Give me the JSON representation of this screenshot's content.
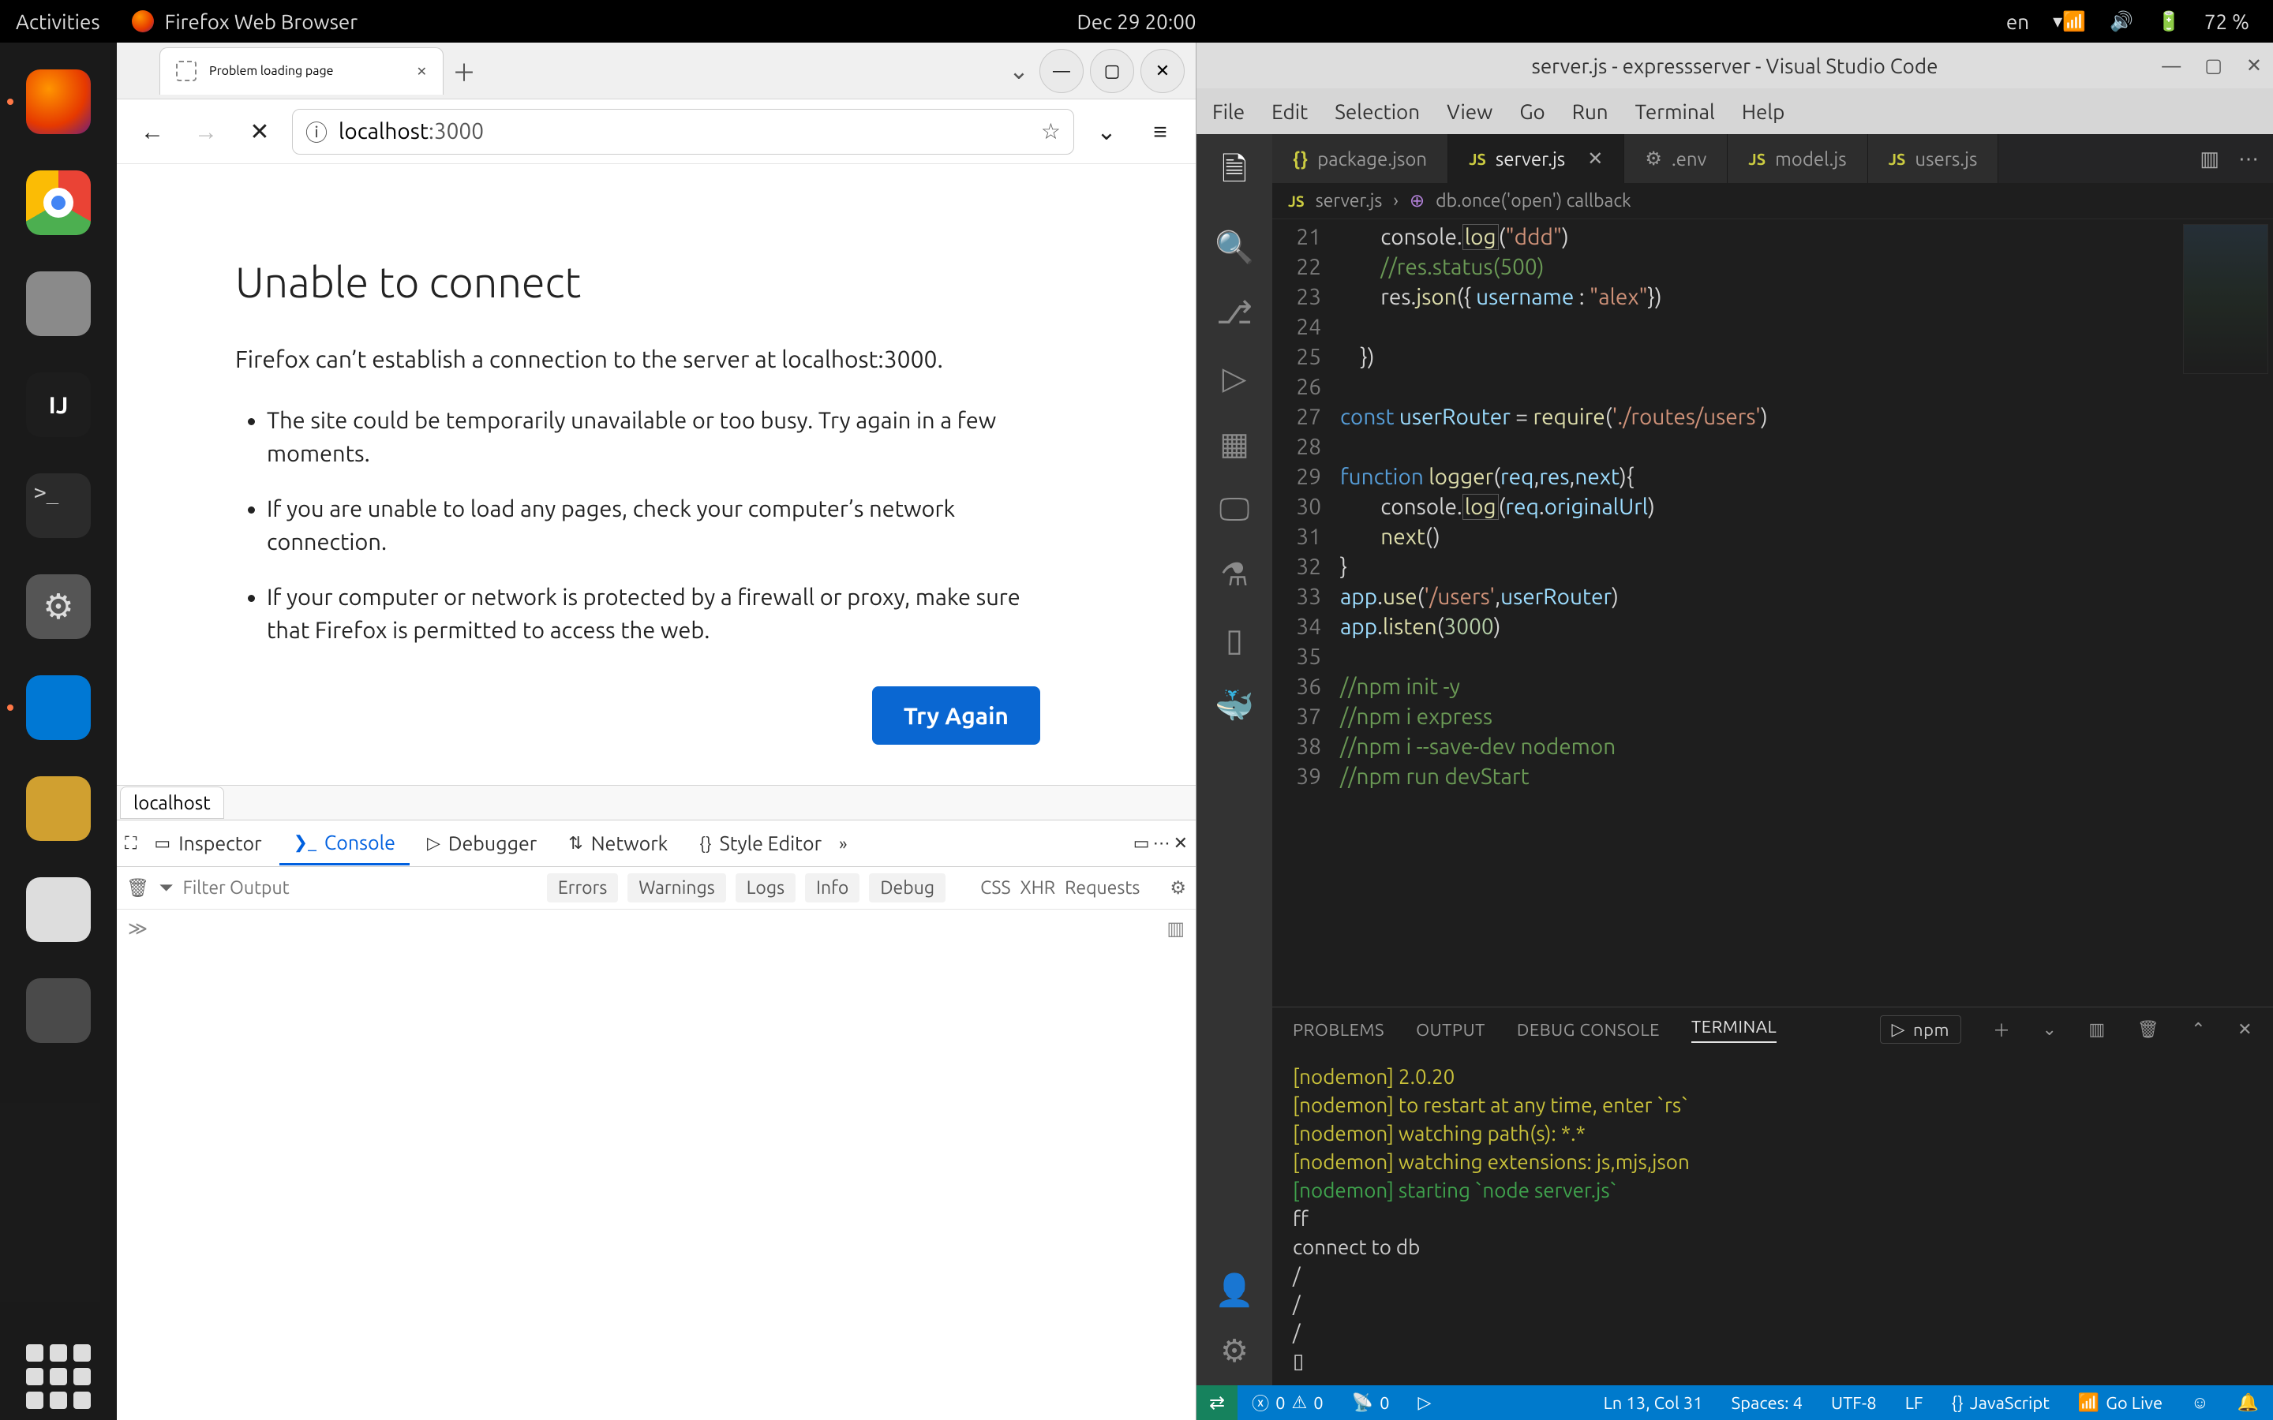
{
  "topbar": {
    "activities": "Activities",
    "app": "Firefox Web Browser",
    "clock": "Dec 29  20:00",
    "lang": "en",
    "battery": "72 %"
  },
  "dock": {
    "items": [
      "firefox",
      "chrome",
      "files",
      "intellij",
      "terminal",
      "settings",
      "vscode",
      "mail",
      "generic1",
      "trash"
    ],
    "intellij_label": "IJ",
    "term_label": ">_"
  },
  "firefox": {
    "tab_title": "Problem loading page",
    "url_host": "localhost",
    "url_port": ":3000",
    "page": {
      "heading": "Unable to connect",
      "subtext": "Firefox can’t establish a connection to the server at localhost:3000.",
      "bullets": [
        "The site could be temporarily unavailable or too busy. Try again in a few moments.",
        "If you are unable to load any pages, check your computer’s network connection.",
        "If your computer or network is protected by a firewall or proxy, make sure that Firefox is permitted to access the web."
      ],
      "try_again": "Try Again"
    },
    "hostline": "localhost",
    "devtools": {
      "tabs": [
        "Inspector",
        "Console",
        "Debugger",
        "Network",
        "Style Editor"
      ],
      "filter_placeholder": "Filter Output",
      "chips": [
        "Errors",
        "Warnings",
        "Logs",
        "Info",
        "Debug"
      ],
      "chips2": [
        "CSS",
        "XHR",
        "Requests"
      ]
    }
  },
  "vscode": {
    "title": "server.js - expressserver - Visual Studio Code",
    "menu": [
      "File",
      "Edit",
      "Selection",
      "View",
      "Go",
      "Run",
      "Terminal",
      "Help"
    ],
    "tabs": [
      {
        "icon": "brace",
        "label": "package.json"
      },
      {
        "icon": "js",
        "label": "server.js",
        "active": true,
        "close": true
      },
      {
        "icon": "gear",
        "label": ".env"
      },
      {
        "icon": "js",
        "label": "model.js"
      },
      {
        "icon": "js",
        "label": "users.js"
      }
    ],
    "crumbs": {
      "file": "server.js",
      "symbol": "db.once('open') callback"
    },
    "gutter_start": 21,
    "gutter_end": 39,
    "breakpoint_line": 27,
    "code_lines": [
      {
        "n": 21,
        "html": "        console.<span class='tk-fn tk-box'>log</span>(<span class='tk-str'>\"ddd\"</span>)"
      },
      {
        "n": 22,
        "html": "        <span class='tk-cm'>//res.status(500)</span>"
      },
      {
        "n": 23,
        "html": "        res.<span class='tk-fn'>json</span>({ <span class='tk-var'>username</span> : <span class='tk-str'>\"alex\"</span>})"
      },
      {
        "n": 24,
        "html": ""
      },
      {
        "n": 25,
        "html": "    })"
      },
      {
        "n": 26,
        "html": ""
      },
      {
        "n": 27,
        "html": "<span class='tk-kw'>const</span> <span class='tk-var'>userRouter</span> = <span class='tk-fn'>require</span>(<span class='tk-str'>'./routes/users'</span>)"
      },
      {
        "n": 28,
        "html": ""
      },
      {
        "n": 29,
        "html": "<span class='tk-kw'>function</span> <span class='tk-fn'>logger</span>(<span class='tk-var'>req</span>,<span class='tk-var'>res</span>,<span class='tk-var'>next</span>){"
      },
      {
        "n": 30,
        "html": "        console.<span class='tk-fn tk-box'>log</span>(<span class='tk-var'>req</span>.<span class='tk-var'>originalUrl</span>)"
      },
      {
        "n": 31,
        "html": "        <span class='tk-fn'>next</span>()"
      },
      {
        "n": 32,
        "html": "}"
      },
      {
        "n": 33,
        "html": "<span class='tk-var'>app</span>.<span class='tk-fn'>use</span>(<span class='tk-str'>'/users'</span>,<span class='tk-var'>userRouter</span>)"
      },
      {
        "n": 34,
        "html": "<span class='tk-var'>app</span>.<span class='tk-fn'>listen</span>(<span class='tk-num'>3000</span>)"
      },
      {
        "n": 35,
        "html": ""
      },
      {
        "n": 36,
        "html": "<span class='tk-cm'>//npm init -y</span>"
      },
      {
        "n": 37,
        "html": "<span class='tk-cm'>//npm i express</span>"
      },
      {
        "n": 38,
        "html": "<span class='tk-cm'>//npm i --save-dev nodemon</span>"
      },
      {
        "n": 39,
        "html": "<span class='tk-cm'>//npm run devStart</span>"
      }
    ],
    "panel": {
      "tabs": [
        "PROBLEMS",
        "OUTPUT",
        "DEBUG CONSOLE",
        "TERMINAL"
      ],
      "picker": "npm",
      "terminal_lines": [
        {
          "c": "y",
          "t": "[nodemon] 2.0.20"
        },
        {
          "c": "y",
          "t": "[nodemon] to restart at any time, enter `rs`"
        },
        {
          "c": "y",
          "t": "[nodemon] watching path(s): *.*"
        },
        {
          "c": "y",
          "t": "[nodemon] watching extensions: js,mjs,json"
        },
        {
          "c": "g",
          "t": "[nodemon] starting `node server.js`"
        },
        {
          "c": "",
          "t": "ff"
        },
        {
          "c": "",
          "t": "connect to db"
        },
        {
          "c": "",
          "t": "/"
        },
        {
          "c": "",
          "t": "/"
        },
        {
          "c": "",
          "t": "/"
        },
        {
          "c": "",
          "t": "▯"
        }
      ]
    },
    "status": {
      "errors": "0",
      "warnings": "0",
      "ports": "0",
      "cursor": "Ln 13, Col 31",
      "spaces": "Spaces: 4",
      "encoding": "UTF-8",
      "eol": "LF",
      "lang": "JavaScript",
      "golive": "Go Live"
    }
  }
}
